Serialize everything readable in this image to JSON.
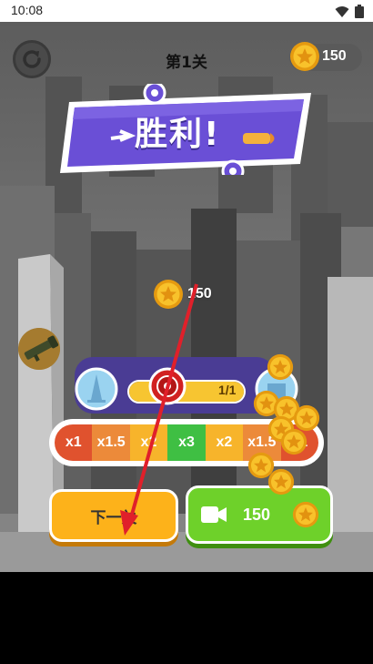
{
  "status_bar": {
    "time": "10:08"
  },
  "header": {
    "level_title": "第1关",
    "coin_balance": "150"
  },
  "banner": {
    "victory_text": "胜利!"
  },
  "reward": {
    "coin_amount": "150"
  },
  "progress": {
    "text": "1/1",
    "fraction": 1.0
  },
  "multipliers": [
    {
      "label": "x1",
      "color": "#e0522e"
    },
    {
      "label": "x1.5",
      "color": "#ec8a3a"
    },
    {
      "label": "x2",
      "color": "#f7b42b"
    },
    {
      "label": "x3",
      "color": "#3fbf43"
    },
    {
      "label": "x2",
      "color": "#f7b42b"
    },
    {
      "label": "x1.5",
      "color": "#ec8a3a"
    },
    {
      "label": "x1",
      "color": "#e0522e"
    }
  ],
  "buttons": {
    "next_level": "下一关",
    "video_reward_amount": "150"
  },
  "colors": {
    "accent_purple": "#6a4fd6",
    "coin_gold": "#f6b91c",
    "next_button": "#fdb21a",
    "video_button": "#6ed12a",
    "arrow_red": "#e0202a"
  },
  "icons": {
    "status": [
      "wifi-icon",
      "battery-icon"
    ],
    "restart": "restart-icon",
    "coin": "coin-star-icon",
    "weapon": "rocket-launcher-icon",
    "video": "video-camera-icon"
  }
}
